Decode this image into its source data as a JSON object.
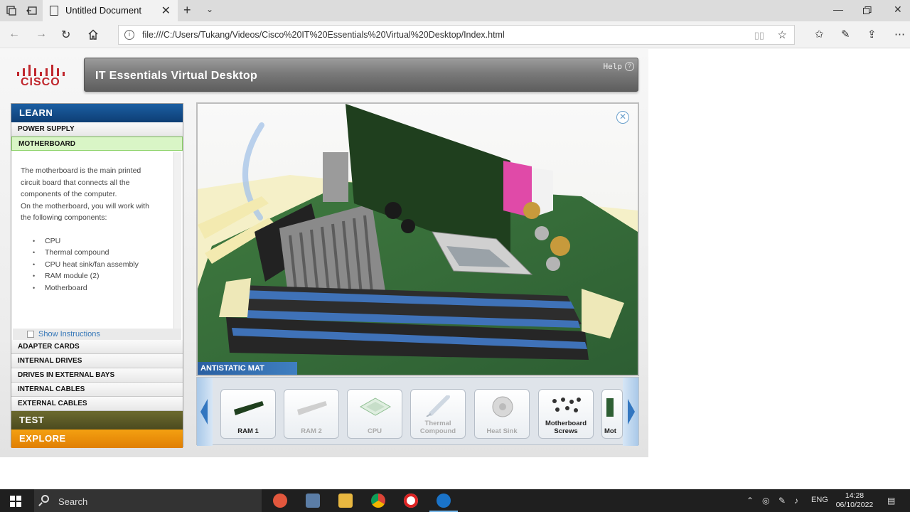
{
  "browser": {
    "tab_title": "Untitled Document",
    "url": "file:///C:/Users/Tukang/Videos/Cisco%20IT%20Essentials%20Virtual%20Desktop/Index.html"
  },
  "app": {
    "logo_text": "CISCO",
    "title": "IT Essentials Virtual Desktop",
    "help_label": "Help"
  },
  "sidebar": {
    "learn_label": "LEARN",
    "items_top": [
      "POWER SUPPLY",
      "MOTHERBOARD"
    ],
    "description_lines": [
      "The motherboard is the main printed",
      "circuit board that connects all the",
      "components of the computer.",
      "On the motherboard, you will work with",
      "the following components:"
    ],
    "components": [
      "CPU",
      "Thermal compound",
      "CPU heat sink/fan assembly",
      "RAM module (2)",
      "Motherboard"
    ],
    "show_instructions": "Show Instructions",
    "items_bottom": [
      "ADAPTER CARDS",
      "INTERNAL DRIVES",
      "DRIVES IN EXTERNAL BAYS",
      "INTERNAL CABLES",
      "EXTERNAL CABLES"
    ],
    "test_label": "TEST",
    "explore_label": "EXPLORE"
  },
  "viewer": {
    "mat_label": "ANTISTATIC MAT"
  },
  "tray": {
    "tiles": [
      {
        "line1": "",
        "line2": "RAM 1"
      },
      {
        "line1": "",
        "line2": "RAM 2"
      },
      {
        "line1": "",
        "line2": "CPU"
      },
      {
        "line1": "Thermal",
        "line2": "Compound"
      },
      {
        "line1": "",
        "line2": "Heat Sink"
      },
      {
        "line1": "Motherboard",
        "line2": "Screws"
      },
      {
        "line1": "",
        "line2": "Mot"
      }
    ]
  },
  "taskbar": {
    "search_text": "Search",
    "lang": "ENG",
    "time": "14:28",
    "date": "06/10/2022"
  },
  "colors": {
    "learn": "#1b5fa3",
    "test": "#5c5a27",
    "explore": "#f0940a",
    "cisco_red": "#c0272d",
    "active_item": "#d9f5c6"
  }
}
